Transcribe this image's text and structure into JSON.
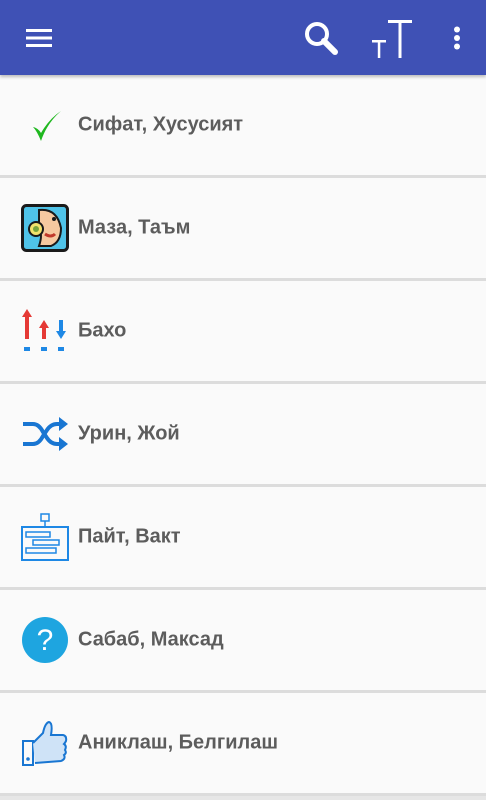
{
  "toolbar": {
    "menu_icon": "hamburger-menu-icon",
    "search_icon": "search-icon",
    "text_size_icon": "text-size-icon",
    "more_icon": "more-vert-icon",
    "color": "#3f51b5"
  },
  "categories": [
    {
      "label": "Сифат, Хусусият",
      "icon": "check-icon"
    },
    {
      "label": "Маза, Таъм",
      "icon": "taste-icon"
    },
    {
      "label": "Бахо",
      "icon": "rating-arrows-icon"
    },
    {
      "label": "Урин, Жой",
      "icon": "shuffle-icon"
    },
    {
      "label": "Пайт, Вакт",
      "icon": "timeline-icon"
    },
    {
      "label": "Сабаб, Максад",
      "icon": "question-icon"
    },
    {
      "label": "Аниклаш, Белгилаш",
      "icon": "thumbs-up-icon"
    }
  ]
}
